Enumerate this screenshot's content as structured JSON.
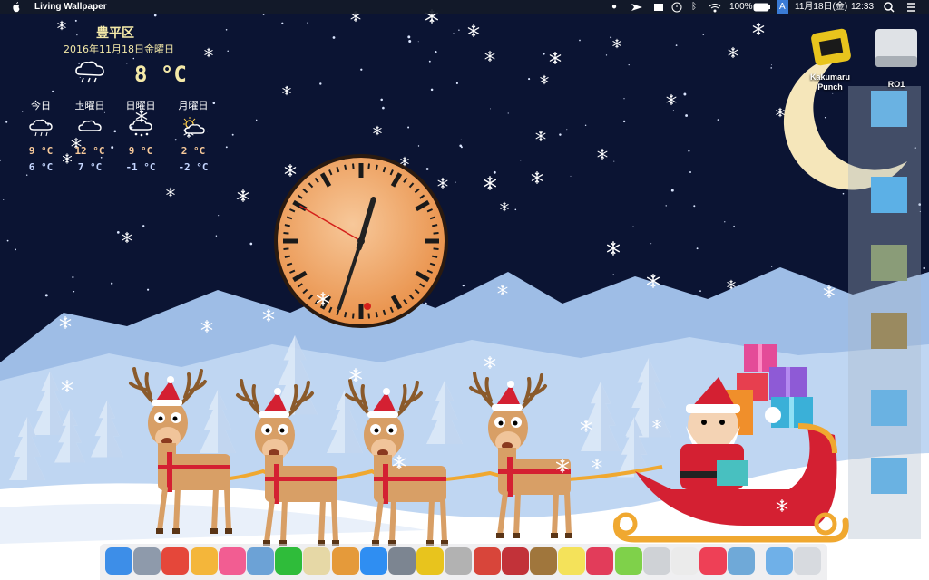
{
  "menubar": {
    "app_name": "Living Wallpaper",
    "battery": "100%",
    "input_source": "A",
    "date": "11月18日(金)",
    "time": "12:33"
  },
  "weather": {
    "location": "豊平区",
    "date": "2016年11月18日金曜日",
    "current_temp": "8 °C",
    "forecast": [
      {
        "day": "今日",
        "high": "9 °C",
        "low": "6 °C",
        "icon": "cloud-rain-icon"
      },
      {
        "day": "土曜日",
        "high": "12 °C",
        "low": "7 °C",
        "icon": "cloud-icon"
      },
      {
        "day": "日曜日",
        "high": "9 °C",
        "low": "-1 °C",
        "icon": "cloud-snow-icon"
      },
      {
        "day": "月曜日",
        "high": "2 °C",
        "low": "-2 °C",
        "icon": "sun-cloud-icon"
      }
    ]
  },
  "desktop": {
    "icons": [
      {
        "label": "Kakumaru Punch",
        "icon": "app-punch-icon"
      },
      {
        "label": "RO1",
        "icon": "hard-drive-icon"
      }
    ]
  },
  "clock": {
    "hour": 12,
    "minute": 33,
    "second": 50
  },
  "colors": {
    "sky": "#0b1433",
    "mountain": "#a8c6ea",
    "snow": "#ffffff",
    "clock_face": "#f0a35a",
    "sleigh": "#d42032"
  },
  "dock": {
    "apps": [
      {
        "name": "finder-icon",
        "color": "#3d8ee8"
      },
      {
        "name": "launchpad-icon",
        "color": "#8e9aab"
      },
      {
        "name": "chrome-icon",
        "color": "#e5473a"
      },
      {
        "name": "photos-icon",
        "color": "#f4b63a"
      },
      {
        "name": "itunes-icon",
        "color": "#f25d92"
      },
      {
        "name": "preview-icon",
        "color": "#6ca2d6"
      },
      {
        "name": "line-icon",
        "color": "#2fbc3a"
      },
      {
        "name": "notes-app-icon",
        "color": "#e6d8a6"
      },
      {
        "name": "sketch-icon",
        "color": "#e59a3a"
      },
      {
        "name": "app-store-icon",
        "color": "#2f8ef2"
      },
      {
        "name": "system-preferences-icon",
        "color": "#7c8591"
      },
      {
        "name": "kakumaru-punch-icon",
        "color": "#e8c41d"
      },
      {
        "name": "photo-booth-icon",
        "color": "#b2b2b2"
      },
      {
        "name": "wunderlist-icon",
        "color": "#d8453a"
      },
      {
        "name": "mindnode-icon",
        "color": "#c23239"
      },
      {
        "name": "alfred-icon",
        "color": "#a0763c"
      },
      {
        "name": "stickies-icon",
        "color": "#f4e25a"
      },
      {
        "name": "airmail-icon",
        "color": "#e23c5a"
      },
      {
        "name": "color-picker-icon",
        "color": "#7fd14a"
      },
      {
        "name": "cleaner-icon",
        "color": "#cfd2d6"
      },
      {
        "name": "pages-icon",
        "color": "#ebebeb"
      },
      {
        "name": "pocket-icon",
        "color": "#ee4056"
      },
      {
        "name": "weather-app-icon",
        "color": "#6fa9d8"
      },
      {
        "name": "downloads-folder-icon",
        "color": "#6fb0e8"
      },
      {
        "name": "trash-icon",
        "color": "#d7dadf"
      }
    ]
  }
}
